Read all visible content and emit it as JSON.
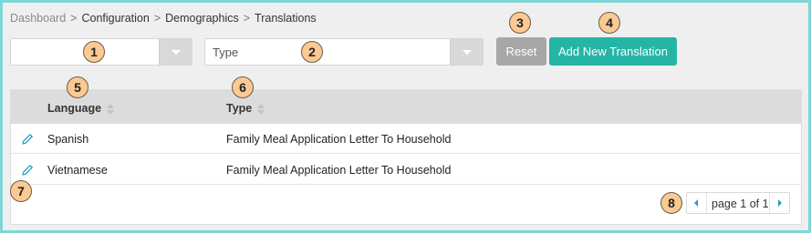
{
  "breadcrumb": {
    "items": [
      "Dashboard",
      "Configuration",
      "Demographics",
      "Translations"
    ],
    "separator": ">"
  },
  "filters": {
    "language_select": {
      "value": ""
    },
    "type_select": {
      "placeholder": "Type"
    }
  },
  "buttons": {
    "reset_label": "Reset",
    "add_label": "Add New Translation"
  },
  "table": {
    "columns": [
      "Language",
      "Type"
    ],
    "rows": [
      {
        "language": "Spanish",
        "type": "Family Meal Application Letter To Household"
      },
      {
        "language": "Vietnamese",
        "type": "Family Meal Application Letter To Household"
      }
    ]
  },
  "pagination": {
    "label": "page 1 of 1"
  },
  "callouts": [
    "1",
    "2",
    "3",
    "4",
    "5",
    "6",
    "7",
    "8"
  ],
  "colors": {
    "accent": "#25b5a6",
    "reset": "#a7a7a7",
    "frame_border": "#7fd6d6",
    "callout": "#fbc993",
    "edit_icon": "#2aa0c8"
  }
}
